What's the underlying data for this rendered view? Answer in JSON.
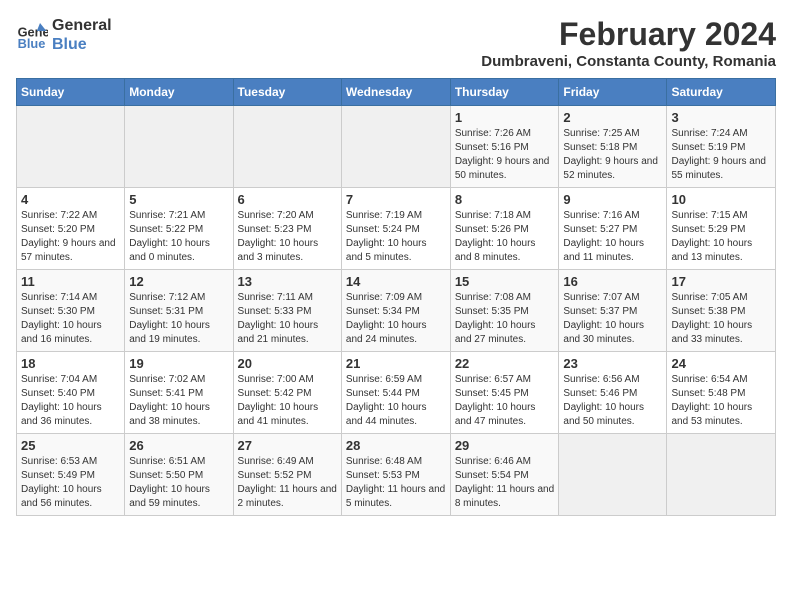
{
  "logo": {
    "line1": "General",
    "line2": "Blue"
  },
  "title": "February 2024",
  "subtitle": "Dumbraveni, Constanta County, Romania",
  "days_of_week": [
    "Sunday",
    "Monday",
    "Tuesday",
    "Wednesday",
    "Thursday",
    "Friday",
    "Saturday"
  ],
  "weeks": [
    [
      {
        "day": "",
        "empty": true
      },
      {
        "day": "",
        "empty": true
      },
      {
        "day": "",
        "empty": true
      },
      {
        "day": "",
        "empty": true
      },
      {
        "day": "1",
        "sunrise": "7:26 AM",
        "sunset": "5:16 PM",
        "daylight": "9 hours and 50 minutes."
      },
      {
        "day": "2",
        "sunrise": "7:25 AM",
        "sunset": "5:18 PM",
        "daylight": "9 hours and 52 minutes."
      },
      {
        "day": "3",
        "sunrise": "7:24 AM",
        "sunset": "5:19 PM",
        "daylight": "9 hours and 55 minutes."
      }
    ],
    [
      {
        "day": "4",
        "sunrise": "7:22 AM",
        "sunset": "5:20 PM",
        "daylight": "9 hours and 57 minutes."
      },
      {
        "day": "5",
        "sunrise": "7:21 AM",
        "sunset": "5:22 PM",
        "daylight": "10 hours and 0 minutes."
      },
      {
        "day": "6",
        "sunrise": "7:20 AM",
        "sunset": "5:23 PM",
        "daylight": "10 hours and 3 minutes."
      },
      {
        "day": "7",
        "sunrise": "7:19 AM",
        "sunset": "5:24 PM",
        "daylight": "10 hours and 5 minutes."
      },
      {
        "day": "8",
        "sunrise": "7:18 AM",
        "sunset": "5:26 PM",
        "daylight": "10 hours and 8 minutes."
      },
      {
        "day": "9",
        "sunrise": "7:16 AM",
        "sunset": "5:27 PM",
        "daylight": "10 hours and 11 minutes."
      },
      {
        "day": "10",
        "sunrise": "7:15 AM",
        "sunset": "5:29 PM",
        "daylight": "10 hours and 13 minutes."
      }
    ],
    [
      {
        "day": "11",
        "sunrise": "7:14 AM",
        "sunset": "5:30 PM",
        "daylight": "10 hours and 16 minutes."
      },
      {
        "day": "12",
        "sunrise": "7:12 AM",
        "sunset": "5:31 PM",
        "daylight": "10 hours and 19 minutes."
      },
      {
        "day": "13",
        "sunrise": "7:11 AM",
        "sunset": "5:33 PM",
        "daylight": "10 hours and 21 minutes."
      },
      {
        "day": "14",
        "sunrise": "7:09 AM",
        "sunset": "5:34 PM",
        "daylight": "10 hours and 24 minutes."
      },
      {
        "day": "15",
        "sunrise": "7:08 AM",
        "sunset": "5:35 PM",
        "daylight": "10 hours and 27 minutes."
      },
      {
        "day": "16",
        "sunrise": "7:07 AM",
        "sunset": "5:37 PM",
        "daylight": "10 hours and 30 minutes."
      },
      {
        "day": "17",
        "sunrise": "7:05 AM",
        "sunset": "5:38 PM",
        "daylight": "10 hours and 33 minutes."
      }
    ],
    [
      {
        "day": "18",
        "sunrise": "7:04 AM",
        "sunset": "5:40 PM",
        "daylight": "10 hours and 36 minutes."
      },
      {
        "day": "19",
        "sunrise": "7:02 AM",
        "sunset": "5:41 PM",
        "daylight": "10 hours and 38 minutes."
      },
      {
        "day": "20",
        "sunrise": "7:00 AM",
        "sunset": "5:42 PM",
        "daylight": "10 hours and 41 minutes."
      },
      {
        "day": "21",
        "sunrise": "6:59 AM",
        "sunset": "5:44 PM",
        "daylight": "10 hours and 44 minutes."
      },
      {
        "day": "22",
        "sunrise": "6:57 AM",
        "sunset": "5:45 PM",
        "daylight": "10 hours and 47 minutes."
      },
      {
        "day": "23",
        "sunrise": "6:56 AM",
        "sunset": "5:46 PM",
        "daylight": "10 hours and 50 minutes."
      },
      {
        "day": "24",
        "sunrise": "6:54 AM",
        "sunset": "5:48 PM",
        "daylight": "10 hours and 53 minutes."
      }
    ],
    [
      {
        "day": "25",
        "sunrise": "6:53 AM",
        "sunset": "5:49 PM",
        "daylight": "10 hours and 56 minutes."
      },
      {
        "day": "26",
        "sunrise": "6:51 AM",
        "sunset": "5:50 PM",
        "daylight": "10 hours and 59 minutes."
      },
      {
        "day": "27",
        "sunrise": "6:49 AM",
        "sunset": "5:52 PM",
        "daylight": "11 hours and 2 minutes."
      },
      {
        "day": "28",
        "sunrise": "6:48 AM",
        "sunset": "5:53 PM",
        "daylight": "11 hours and 5 minutes."
      },
      {
        "day": "29",
        "sunrise": "6:46 AM",
        "sunset": "5:54 PM",
        "daylight": "11 hours and 8 minutes."
      },
      {
        "day": "",
        "empty": true
      },
      {
        "day": "",
        "empty": true
      }
    ]
  ],
  "labels": {
    "sunrise": "Sunrise:",
    "sunset": "Sunset:",
    "daylight": "Daylight:"
  }
}
